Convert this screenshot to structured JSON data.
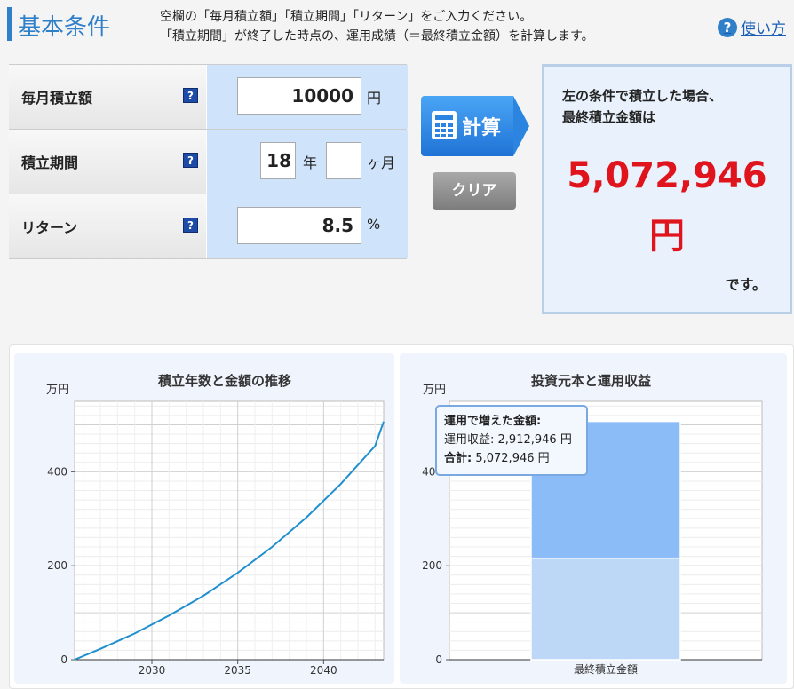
{
  "header": {
    "title": "基本条件",
    "desc_line1": "空欄の「毎月積立額」「積立期間」「リターン」をご入力ください。",
    "desc_line2": "「積立期間」が終了した時点の、運用成績（＝最終積立金額）を計算します。",
    "help_label": "使い方",
    "help_icon": "?"
  },
  "form": {
    "monthly": {
      "label": "毎月積立額",
      "value": "10000",
      "unit": "円"
    },
    "period": {
      "label": "積立期間",
      "years": "18",
      "years_unit": "年",
      "months": "",
      "months_unit": "ヶ月"
    },
    "return": {
      "label": "リターン",
      "value": "8.5",
      "unit": "%"
    },
    "help_icon": "?"
  },
  "buttons": {
    "calc": "計算",
    "clear": "クリア"
  },
  "result": {
    "line1": "左の条件で積立した場合、",
    "line2": "最終積立金額は",
    "amount": "5,072,946",
    "currency": "円",
    "suffix": "です。"
  },
  "tooltip": {
    "title": "運用で増えた金額:",
    "gain_label": "運用収益:",
    "gain_value": "2,912,946 円",
    "total_label": "合計:",
    "total_value": "5,072,946 円"
  },
  "chart_data": [
    {
      "type": "line",
      "title": "積立年数と金額の推移",
      "ylabel": "万円",
      "x": [
        2025.5,
        2027,
        2029,
        2031,
        2033,
        2035,
        2037,
        2039,
        2041,
        2043,
        2043.5
      ],
      "y": [
        0,
        23,
        56,
        94,
        136,
        185,
        240,
        303,
        374,
        455,
        507
      ],
      "ylim": [
        0,
        550
      ],
      "xlim": [
        2025.5,
        2043.5
      ],
      "xticks": [
        "2030",
        "2035",
        "2040"
      ],
      "yticks": [
        "0",
        "200",
        "400"
      ],
      "color": "#1f8fcf",
      "grid": true
    },
    {
      "type": "bar",
      "title": "投資元本と運用収益",
      "ylabel": "万円",
      "categories": [
        "最終積立金額"
      ],
      "series": [
        {
          "values": [
            216
          ],
          "color": "#bcd8f6"
        },
        {
          "values": [
            291.3
          ],
          "color": "#8cbcf8"
        }
      ],
      "stacked": true,
      "ylim": [
        0,
        550
      ],
      "yticks": [
        "0",
        "200",
        "400"
      ],
      "grid": true
    }
  ]
}
